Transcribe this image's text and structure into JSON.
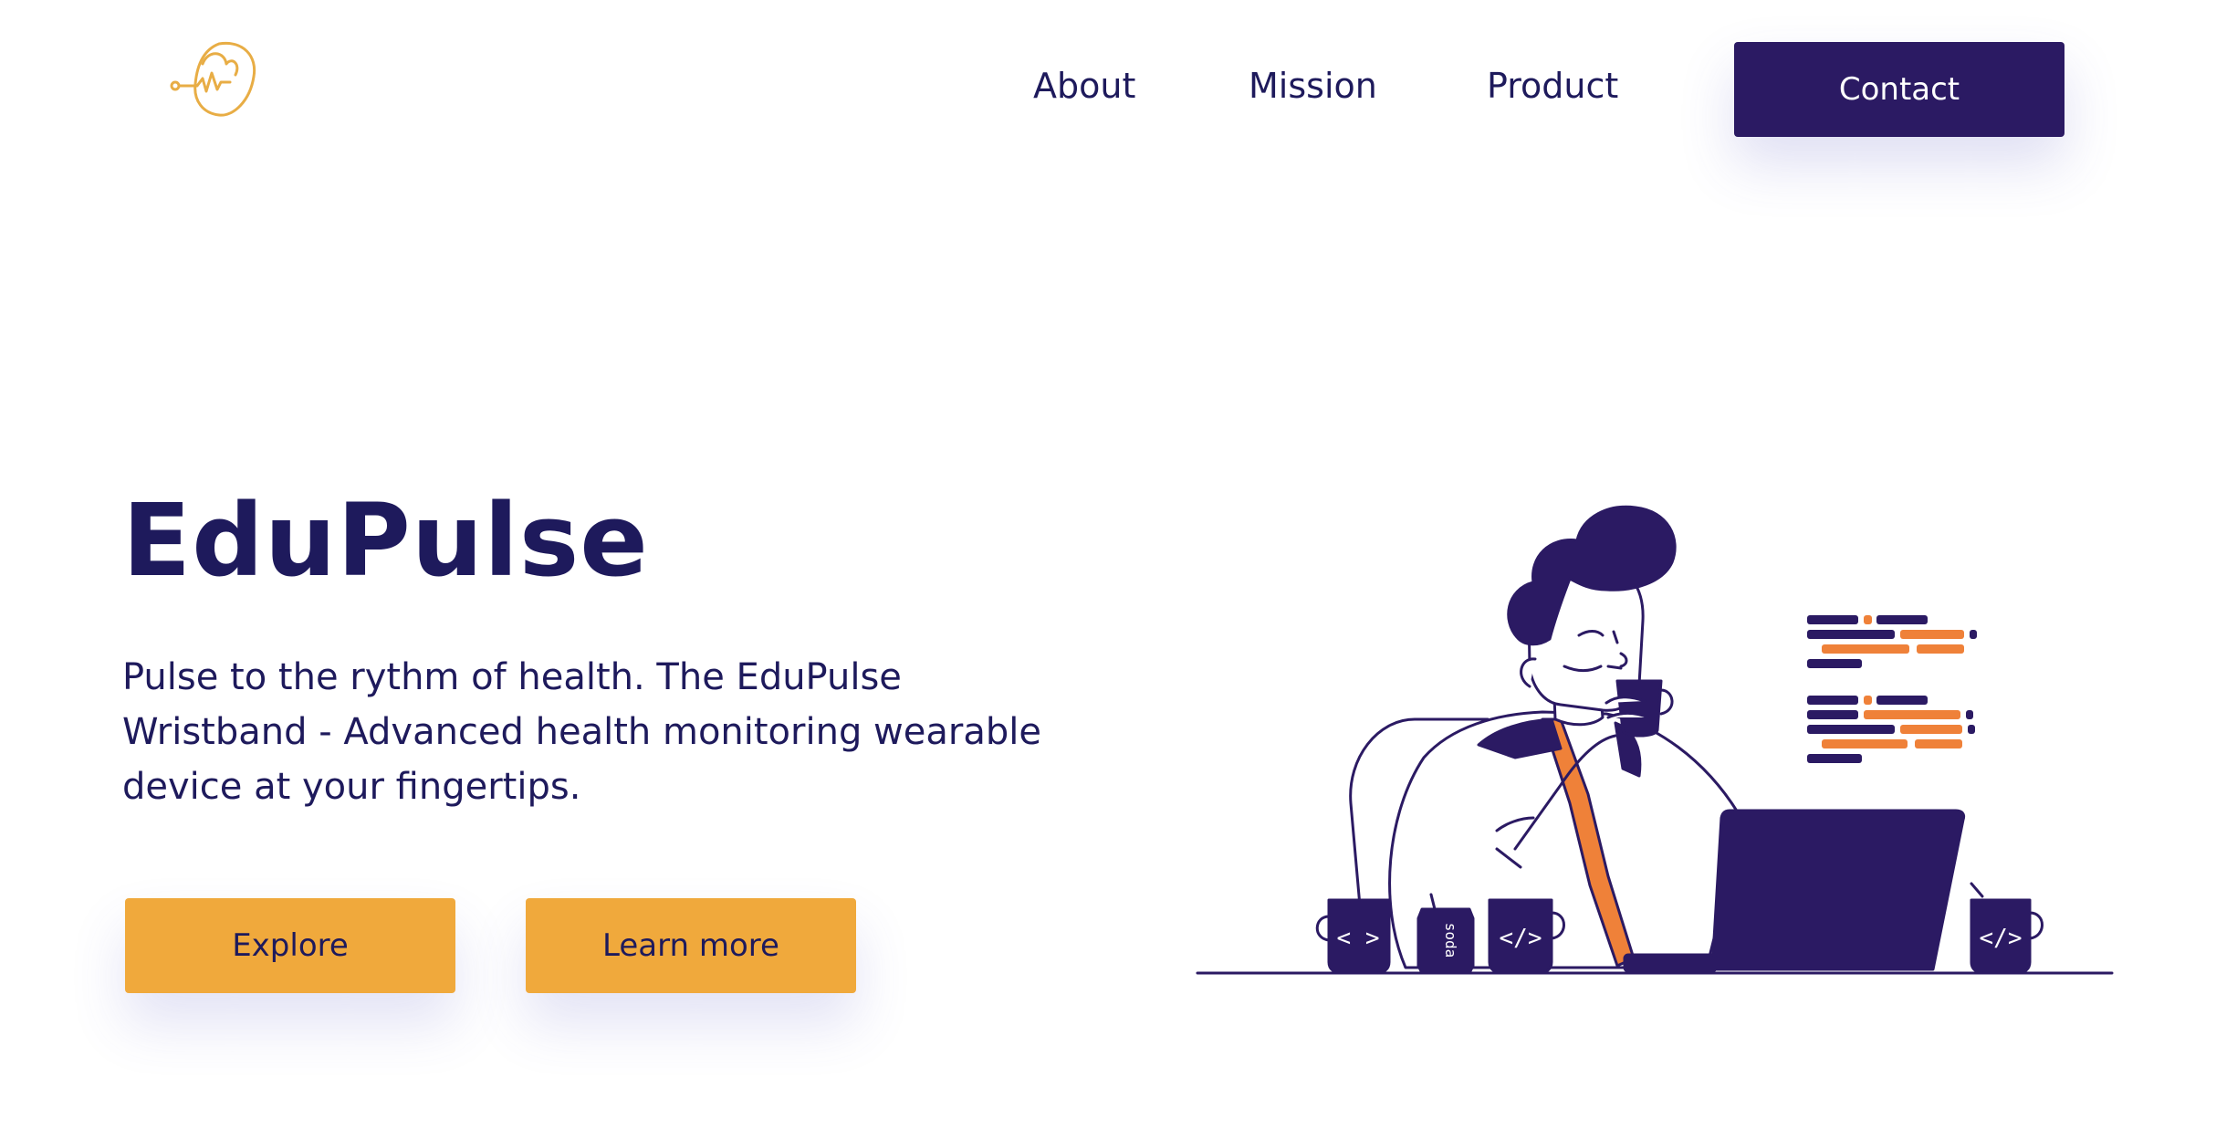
{
  "header": {
    "logo_icon": "heart-pulse-logo-icon",
    "nav": [
      {
        "label": "About"
      },
      {
        "label": "Mission"
      },
      {
        "label": "Product"
      }
    ],
    "contact_label": "Contact"
  },
  "hero": {
    "title": "EduPulse",
    "description": "Pulse to the rythm of health. The EduPulse Wristband - Advanced health monitoring wearable device at your fingertips.",
    "buttons": {
      "explore_label": "Explore",
      "learn_more_label": "Learn more"
    }
  },
  "illustration": {
    "icon": "developer-with-laptop-and-coffee-illustration",
    "mug_labels": [
      "< >",
      "</>",
      "</>"
    ],
    "can_label": "soda"
  },
  "colors": {
    "primary": "#2b1a63",
    "text": "#1e1a5c",
    "accent_button": "#f0a93c",
    "illustration_orange": "#ef8139",
    "logo_gold": "#e8ad45",
    "background": "#ffffff"
  }
}
